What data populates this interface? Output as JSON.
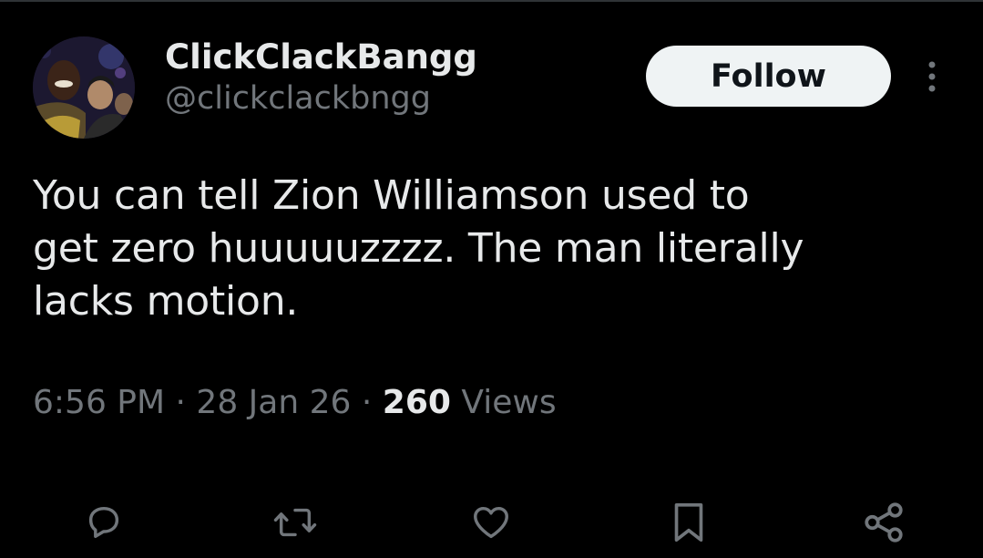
{
  "author": {
    "display_name": "ClickClackBangg",
    "handle": "@clickclackbngg",
    "avatar_icon": "profile-photo"
  },
  "follow_label": "Follow",
  "more_icon": "more-vertical-icon",
  "tweet": {
    "text_lines": [
      "You can tell Zion Williamson used to",
      "get zero huuuuuzzzz. The man literally",
      "lacks motion."
    ]
  },
  "meta": {
    "time": "6:56 PM",
    "separator": "·",
    "date": "28 Jan 26",
    "views_count": "260",
    "views_label": "Views"
  },
  "actions": [
    {
      "name": "reply",
      "icon": "reply-icon"
    },
    {
      "name": "retweet",
      "icon": "retweet-icon"
    },
    {
      "name": "like",
      "icon": "heart-icon"
    },
    {
      "name": "bookmark",
      "icon": "bookmark-icon"
    },
    {
      "name": "share",
      "icon": "share-icon"
    }
  ],
  "colors": {
    "background": "#000000",
    "primary_text": "#e7e9ea",
    "secondary_text": "#71767b",
    "follow_bg": "#eff3f4",
    "follow_text": "#0f1419"
  }
}
